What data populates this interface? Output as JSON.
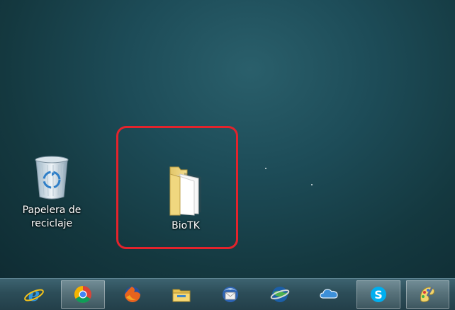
{
  "desktop": {
    "icons": [
      {
        "label_line1": "Papelera de",
        "label_line2": "reciclaje",
        "icon": "recycle-bin-icon"
      },
      {
        "label": "BioTK",
        "icon": "folder-icon"
      }
    ]
  },
  "taskbar": {
    "buttons": [
      {
        "icon": "internet-explorer-icon",
        "active": false
      },
      {
        "icon": "chrome-icon",
        "active": true
      },
      {
        "icon": "firefox-icon",
        "active": false
      },
      {
        "icon": "file-explorer-icon",
        "active": false
      },
      {
        "icon": "thunderbird-icon",
        "active": false
      },
      {
        "icon": "google-earth-icon",
        "active": false
      },
      {
        "icon": "onedrive-icon",
        "active": false
      },
      {
        "icon": "skype-icon",
        "active": true
      },
      {
        "icon": "paint-icon",
        "active": true
      }
    ]
  },
  "colors": {
    "highlight": "#e3232c",
    "desktop_bg": "#1d4c58",
    "taskbar_bg": "#2c4d58"
  }
}
